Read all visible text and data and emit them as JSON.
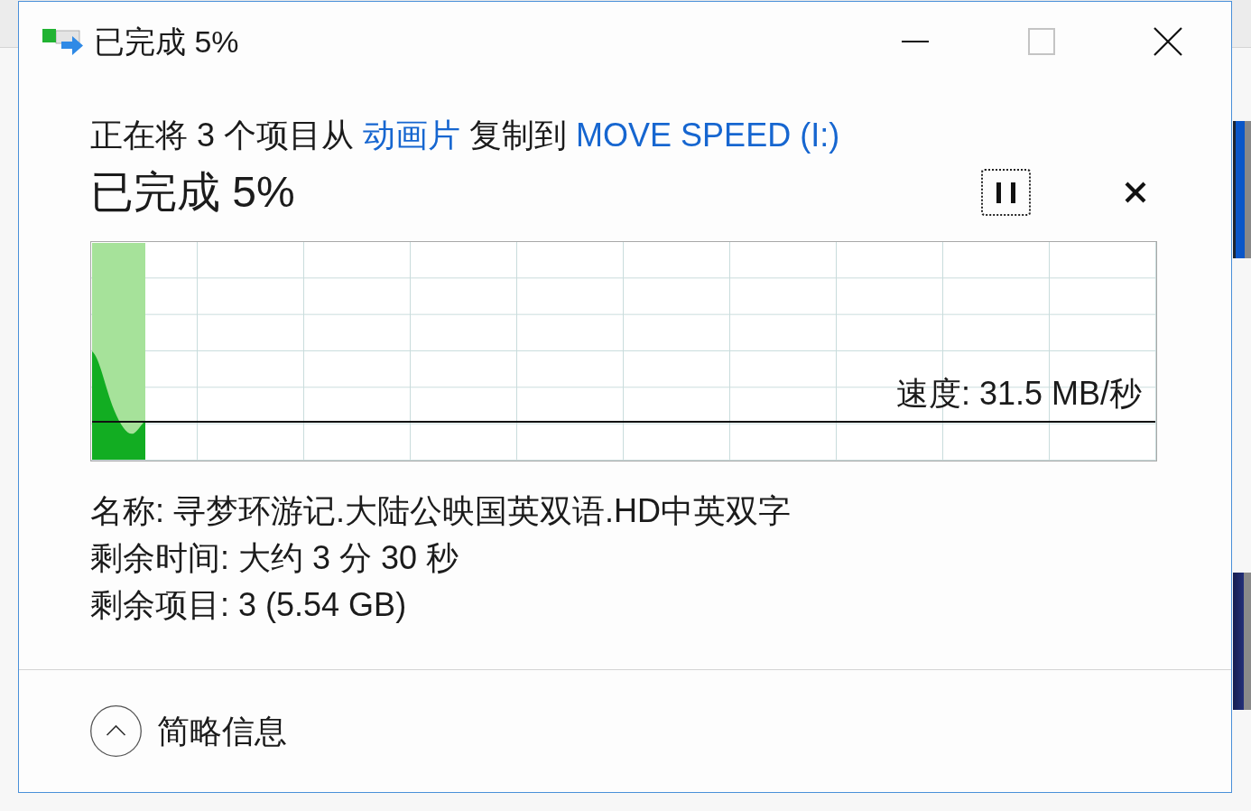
{
  "window": {
    "title": "已完成 5%",
    "controls": [
      {
        "kind": "minimize",
        "disabled": false
      },
      {
        "kind": "maximize",
        "disabled": true
      },
      {
        "kind": "close",
        "disabled": false
      }
    ]
  },
  "copy_summary": [
    {
      "kind": "text",
      "text": "正在将 3 个项目从"
    },
    {
      "kind": "link",
      "text": "动画片"
    },
    {
      "kind": "text",
      "text": "复制到"
    },
    {
      "kind": "link",
      "text": "MOVE SPEED (I:)"
    }
  ],
  "progress": {
    "title": "已完成 5%",
    "level": 0.05,
    "speed": "速度: 31.5 MB/秒"
  },
  "details": [
    {
      "label": "名称:",
      "value": "寻梦环游记.大陆公映国英双语.HD中英双字"
    },
    {
      "label": "剩余时间:",
      "value": "大约 3 分 30 秒"
    },
    {
      "label": "剩余项目:",
      "value": "3 (5.54 GB)"
    }
  ],
  "footer": {
    "toggle": {
      "label": "简略信息",
      "expanded": true
    }
  }
}
